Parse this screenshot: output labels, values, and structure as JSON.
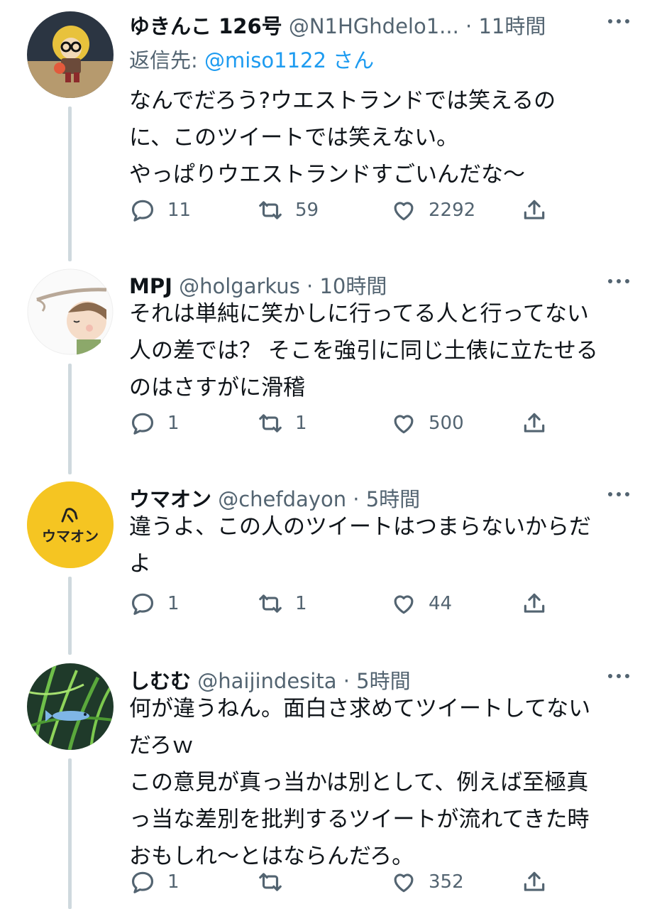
{
  "tweets": [
    {
      "name": "ゆきんこ 126号",
      "handle": "@N1HGhdelo1...",
      "dot": "·",
      "time": "11時間",
      "reply_prefix": "返信先: ",
      "reply_mention": "@miso1122",
      "reply_suffix": " さん",
      "text": "なんでだろう?ウエストランドでは笑えるの\nに、このツイートでは笑えない。\nやっぱりウエストランドすごいんだな〜",
      "replies": "11",
      "retweets": "59",
      "likes": "2292"
    },
    {
      "name": "MPJ",
      "handle": "@holgarkus",
      "dot": "·",
      "time": "10時間",
      "text": "それは単純に笑かしに行ってる人と行ってない\n人の差では？ そこを強引に同じ土俵に立たせる\nのはさすがに滑稽",
      "replies": "1",
      "retweets": "1",
      "likes": "500"
    },
    {
      "name": "ウマオン",
      "handle": "@chefdayon",
      "dot": "·",
      "time": "5時間",
      "avatar_text": "ウマオン",
      "text": "違うよ、この人のツイートはつまらないからだ\nよ",
      "replies": "1",
      "retweets": "1",
      "likes": "44"
    },
    {
      "name": "しむむ",
      "handle": "@haijindesita",
      "dot": "·",
      "time": "5時間",
      "text": "何が違うねん。面白さ求めてツイートしてない\nだろｗ\nこの意見が真っ当かは別として、例えば至極真\nっ当な差別を批判するツイートが流れてきた時\nおもしれ〜とはならんだろ。",
      "replies": "1",
      "retweets": "",
      "likes": "352"
    }
  ],
  "icons": {
    "reply": "speech-bubble",
    "retweet": "retweet-arrows",
    "like": "heart",
    "share": "share-upload",
    "more": "ellipsis"
  },
  "colors": {
    "link": "#1d9bf0",
    "secondary": "#536471",
    "thread_line": "#cfd9de",
    "umaon_avatar": "#f5c522"
  }
}
